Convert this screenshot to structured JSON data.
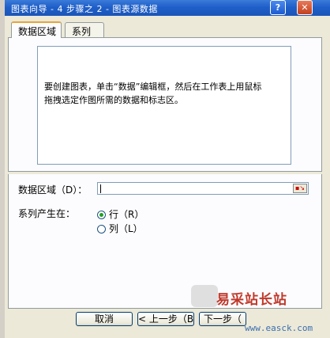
{
  "window": {
    "title": "图表向导 - 4 步骤之 2 - 图表源数据",
    "help_label": "?",
    "close_label": "✕"
  },
  "tabs": [
    {
      "label": "数据区域",
      "active": true
    },
    {
      "label": "系列",
      "active": false
    }
  ],
  "instructions": {
    "line1": "要创建图表，单击“数据”编辑框，然后在工作表上用鼠标",
    "line2": "拖拽选定作图所需的数据和标志区。"
  },
  "data_range": {
    "label": "数据区域（D）：",
    "value": ""
  },
  "series_in": {
    "label": "系列产生在：",
    "options": [
      {
        "label": "行（R）",
        "checked": true
      },
      {
        "label": "列（L）",
        "checked": false
      }
    ]
  },
  "buttons": {
    "cancel": "取消",
    "back": "< 上一步（B）",
    "next": "下一步（"
  },
  "watermark": {
    "site_name": "易采站长站",
    "url": "www.easck.com"
  },
  "colors": {
    "titlebar": "#1f5fc9",
    "dialog_bg": "#ece9d8",
    "active_tab_accent": "#e7a43b",
    "radio_checked": "#21a121"
  }
}
